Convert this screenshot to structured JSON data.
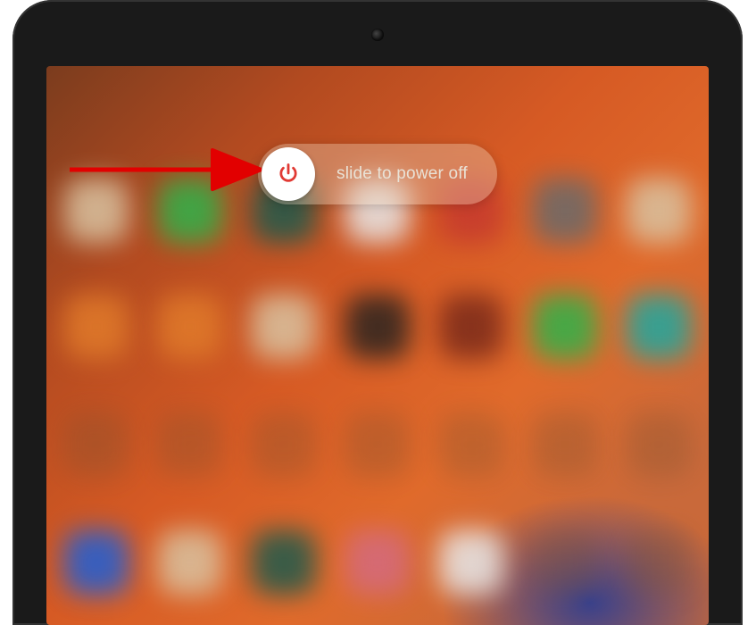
{
  "slider": {
    "label": "slide to power off",
    "icon_name": "power-icon",
    "icon_color": "#E13A34",
    "knob_color": "#FFFFFF",
    "track_tint": "rgba(235,220,200,0.34)"
  },
  "annotation": {
    "type": "arrow",
    "color": "#E20000",
    "points_to": "slider-knob"
  },
  "device": {
    "type": "tablet",
    "frame_color": "#1a1a1a"
  }
}
